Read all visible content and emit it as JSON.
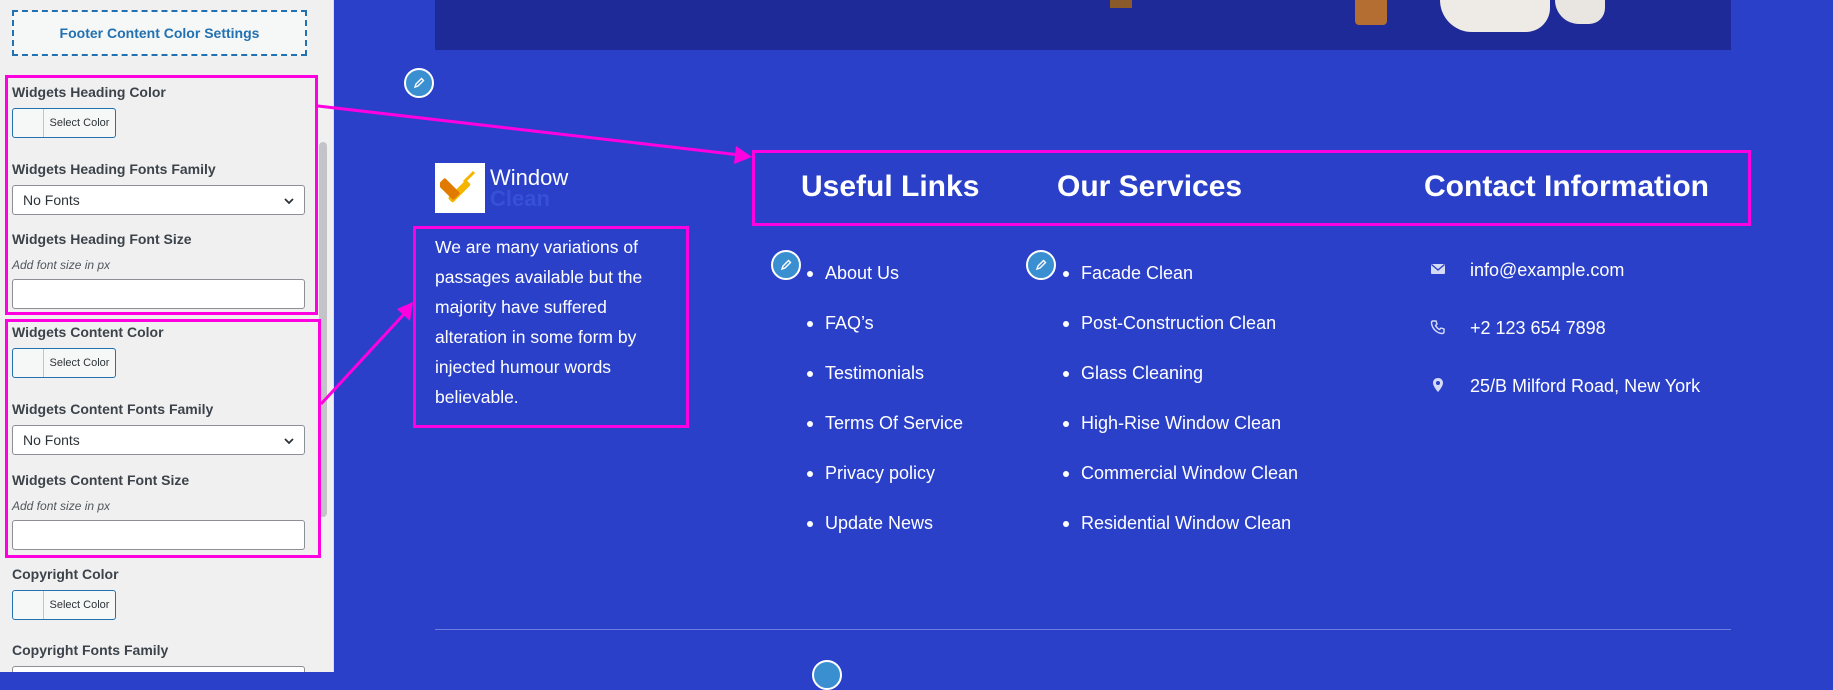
{
  "sidebar": {
    "section_title": "Footer Content Color Settings",
    "widgets_heading_color_label": "Widgets Heading Color",
    "widgets_heading_fonts_label": "Widgets Heading Fonts Family",
    "widgets_heading_font_size_label": "Widgets Heading Font Size",
    "widgets_content_color_label": "Widgets Content Color",
    "widgets_content_fonts_label": "Widgets Content Fonts Family",
    "widgets_content_font_size_label": "Widgets Content Font Size",
    "copyright_color_label": "Copyright Color",
    "copyright_fonts_label": "Copyright Fonts Family",
    "select_color": "Select Color",
    "no_fonts": "No Fonts",
    "font_size_hint": "Add font size in px"
  },
  "footer": {
    "logo_line1": "Window",
    "logo_line2": "Clean",
    "about": "We are many variations of passages available but the majority have suffered alteration in some form by injected humour words believable.",
    "useful_links_heading": "Useful Links",
    "our_services_heading": "Our Services",
    "contact_heading": "Contact Information",
    "useful_links": [
      "About Us",
      "FAQ’s",
      "Testimonials",
      "Terms Of Service",
      "Privacy policy",
      "Update News"
    ],
    "services": [
      "Facade Clean",
      "Post-Construction Clean",
      "Glass Cleaning",
      "High-Rise Window Clean",
      "Commercial Window Clean",
      "Residential Window Clean"
    ],
    "contact": {
      "email": "info@example.com",
      "phone": "+2 123 654 7898",
      "address": "25/B Milford Road, New York"
    }
  },
  "colors": {
    "highlight": "#ff00e0",
    "footer_bg": "#2a40c9",
    "accent": "#2271b1"
  }
}
